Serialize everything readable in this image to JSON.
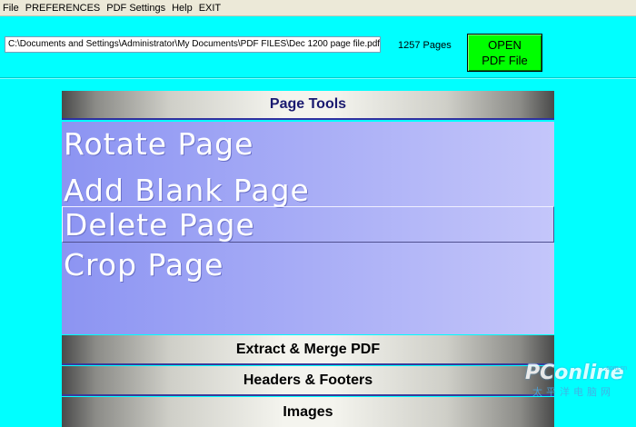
{
  "menu": {
    "items": [
      "File",
      "PREFERENCES",
      "PDF Settings",
      "Help",
      "EXIT"
    ]
  },
  "file": {
    "path": "C:\\Documents and Settings\\Administrator\\My Documents\\PDF FILES\\Dec 1200 page file.pdf",
    "pages_label": "1257 Pages"
  },
  "open_button": {
    "line1": "OPEN",
    "line2": "PDF File"
  },
  "sections": {
    "page_tools": "Page Tools",
    "extract": "Extract & Merge PDF",
    "headers": "Headers & Footers",
    "images": "Images"
  },
  "tools": {
    "rotate": "Rotate Page",
    "add_blank": "Add Blank Page",
    "delete": "Delete Page",
    "crop": "Crop Page"
  },
  "watermark": {
    "logo": "PConline",
    "sub": "太平洋电脑网",
    "domain": ".com.cn"
  },
  "colors": {
    "background": "#00ffff",
    "tools_panel": "#a8adf6",
    "open_button": "#00ff00",
    "section_title_text": "#1a1a70"
  }
}
